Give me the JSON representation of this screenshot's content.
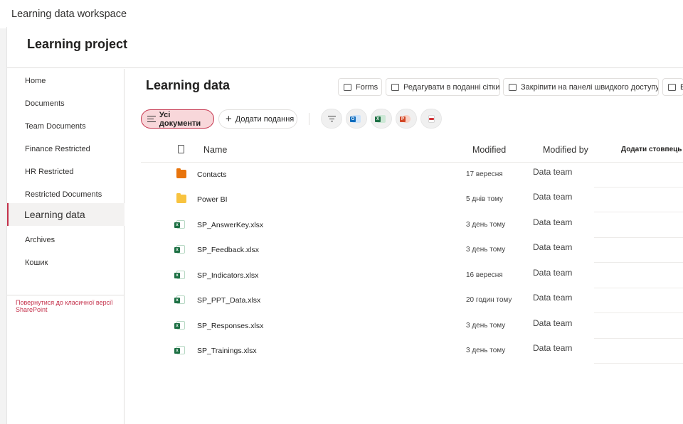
{
  "workspace": {
    "title": "Learning data workspace"
  },
  "site": {
    "title": "Learning project"
  },
  "nav": {
    "items": [
      {
        "label": "Home"
      },
      {
        "label": "Documents"
      },
      {
        "label": "Team Documents"
      },
      {
        "label": "Finance Restricted"
      },
      {
        "label": "HR Restricted"
      },
      {
        "label": "Restricted Documents"
      },
      {
        "label": "Learning data",
        "active": true
      },
      {
        "label": "Archives"
      },
      {
        "label": "Кошик"
      }
    ],
    "classic_link": "Повернутися до класичної версії SharePoint"
  },
  "library": {
    "title": "Learning data",
    "commands": {
      "forms": "Forms",
      "grid_edit": "Редагувати в поданні сітки",
      "pin": "Закріпити на панелі швидкого доступу",
      "more": "Ei"
    },
    "views": {
      "current": "Усі документи",
      "add_view": "Додати подання"
    },
    "app_icons": [
      "outlook-icon",
      "excel-icon",
      "powerpoint-icon",
      "pdf-icon"
    ],
    "columns": {
      "name": "Name",
      "modified": "Modified",
      "modified_by": "Modified by",
      "add_column": "Додати стовпець"
    },
    "files": [
      {
        "name": "Contacts",
        "type": "folder",
        "color": "#e8740c",
        "modified": "17 вересня",
        "modified_by": "Data team"
      },
      {
        "name": "Power BI",
        "type": "folder",
        "color": "#f8c33f",
        "modified": "5 днів тому",
        "modified_by": "Data team"
      },
      {
        "name": "SP_AnswerKey.xlsx",
        "type": "xlsx",
        "modified": "3 день тому",
        "modified_by": "Data team"
      },
      {
        "name": "SP_Feedback.xlsx",
        "type": "xlsx",
        "modified": "3 день тому",
        "modified_by": "Data team"
      },
      {
        "name": "SP_Indicators.xlsx",
        "type": "xlsx",
        "modified": "16 вересня",
        "modified_by": "Data team"
      },
      {
        "name": "SP_PPT_Data.xlsx",
        "type": "xlsx",
        "modified": "20 годин тому",
        "modified_by": "Data team"
      },
      {
        "name": "SP_Responses.xlsx",
        "type": "xlsx",
        "modified": "3 день тому",
        "modified_by": "Data team"
      },
      {
        "name": "SP_Trainings.xlsx",
        "type": "xlsx",
        "modified": "3 день тому",
        "modified_by": "Data team"
      }
    ]
  },
  "colors": {
    "accent": "#c4314b",
    "excel": "#1d7044",
    "outlook": "#0f6cbd",
    "powerpoint": "#d24726",
    "pdf": "#d13438"
  }
}
